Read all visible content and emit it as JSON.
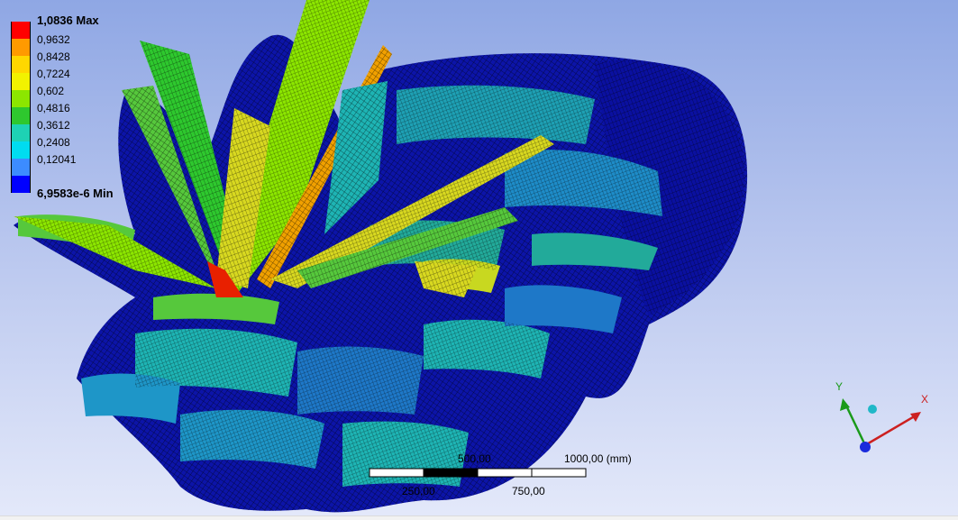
{
  "legend": {
    "entries": [
      {
        "label": "1,0836 Max",
        "color": "#ff0000"
      },
      {
        "label": "0,9632",
        "color": "#ff9a00"
      },
      {
        "label": "0,8428",
        "color": "#ffd700"
      },
      {
        "label": "0,7224",
        "color": "#f2f200"
      },
      {
        "label": "0,602",
        "color": "#8ce600"
      },
      {
        "label": "0,4816",
        "color": "#2ec82e"
      },
      {
        "label": "0,3612",
        "color": "#1ed2b4"
      },
      {
        "label": "0,2408",
        "color": "#00dcf0"
      },
      {
        "label": "0,12041",
        "color": "#3c8cff"
      },
      {
        "label": "6,9583e-6 Min",
        "color": "#0000ff"
      }
    ]
  },
  "scale_bar": {
    "top_labels": [
      "500,00",
      "1000,00 (mm)"
    ],
    "bottom_labels": [
      "250,00",
      "750,00"
    ],
    "colors": {
      "dark": "#000000",
      "light": "#ffffff"
    }
  },
  "triad": {
    "x_label": "X",
    "y_label": "Y",
    "colors": {
      "x": "#cc2020",
      "y": "#1a9a1a",
      "z": "#1a2adc",
      "iso": "#20b8c8",
      "x_text": "#cc2020",
      "y_text": "#1a9a1a"
    }
  },
  "model": {
    "colors": {
      "deep": "#0c14a8",
      "blue": "#1e3cdc",
      "mid": "#1878c8",
      "cyan": "#1eb4b4",
      "teal": "#22aa9a",
      "green": "#56c83c",
      "yellow": "#d8d820",
      "orange": "#f0a000",
      "red": "#e82000"
    }
  }
}
